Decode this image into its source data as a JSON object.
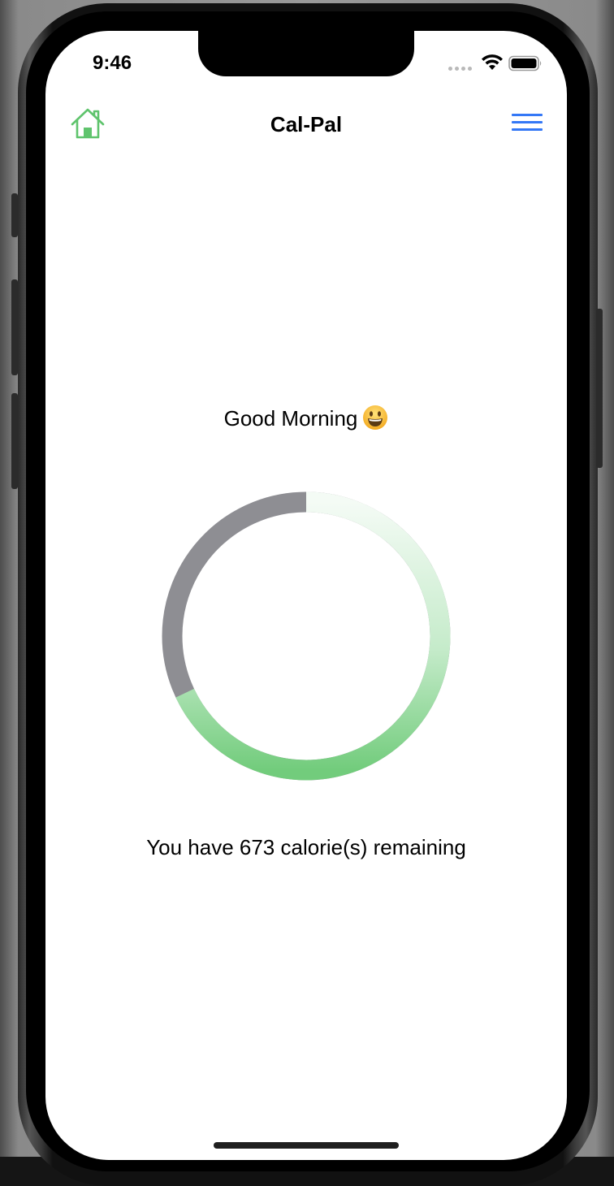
{
  "status_bar": {
    "time": "9:46",
    "wifi_icon": "wifi-icon",
    "battery_icon": "battery-icon"
  },
  "nav": {
    "title": "Cal-Pal",
    "home_icon": "home-icon",
    "menu_icon": "hamburger-menu-icon"
  },
  "main": {
    "greeting": "Good Morning",
    "greeting_emoji": "smiling-face-emoji",
    "remaining_text": "You have 673 calorie(s) remaining"
  },
  "calorie_ring": {
    "progress_fraction": 0.68,
    "colors": {
      "remaining_gray": "#8e8e93",
      "consumed_green": "#72cc7c",
      "consumed_green_faded": "#f4fbf5"
    }
  },
  "colors": {
    "accent_green": "#5fc46d",
    "accent_blue": "#3478f6"
  }
}
